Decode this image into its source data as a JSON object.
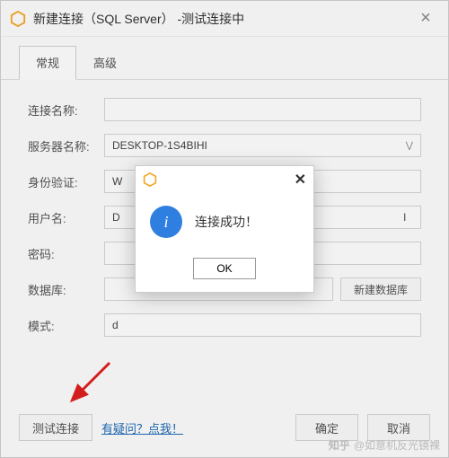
{
  "window": {
    "title": "新建连接（SQL Server） -测试连接中"
  },
  "tabs": {
    "general": "常规",
    "advanced": "高级"
  },
  "labels": {
    "conn_name": "连接名称:",
    "server_name": "服务器名称:",
    "auth": "身份验证:",
    "username": "用户名:",
    "password": "密码:",
    "database": "数据库:",
    "schema": "模式:"
  },
  "values": {
    "conn_name": "",
    "server_name": "DESKTOP-1S4BIHI",
    "auth_partial": "W",
    "username_partial": "D",
    "username_suffix": "l",
    "password": "",
    "database": "",
    "schema_partial": "d"
  },
  "buttons": {
    "new_db": "新建数据库",
    "test": "测试连接",
    "help": "有疑问？点我！",
    "ok": "确定",
    "cancel": "取消"
  },
  "modal": {
    "message": "连接成功！",
    "ok": "OK"
  },
  "watermark": {
    "brand": "知乎",
    "author": "@如意机反光镜裸"
  }
}
